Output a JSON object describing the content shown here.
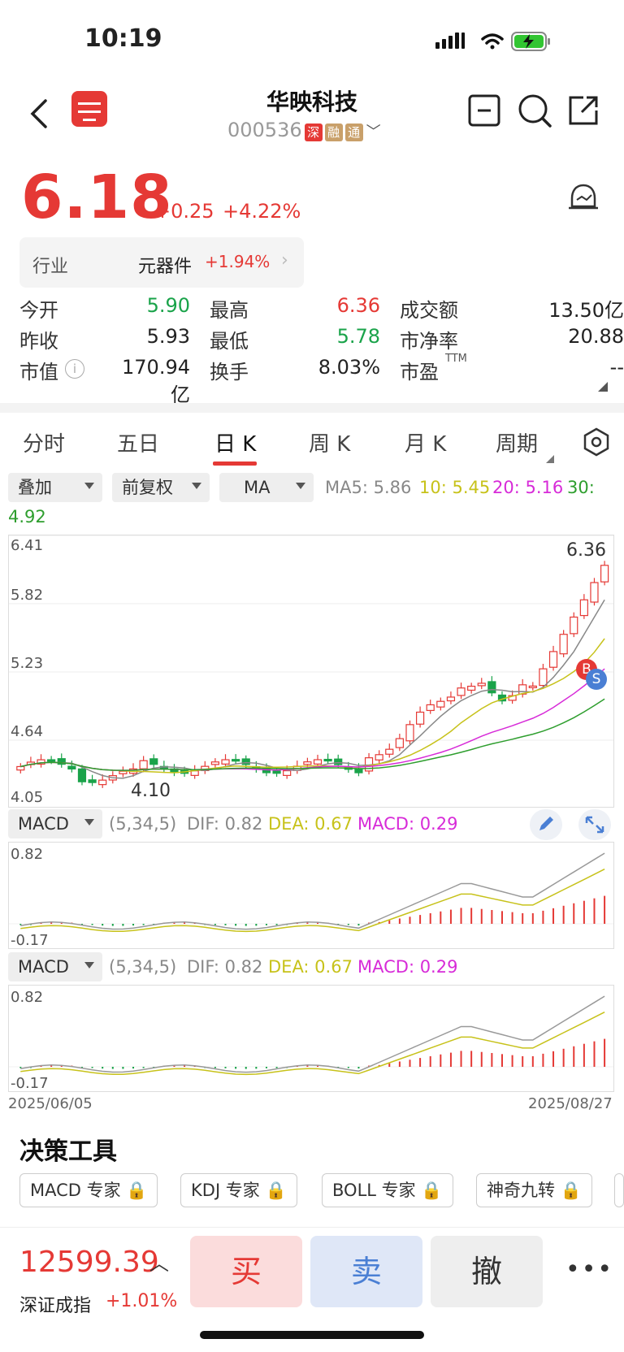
{
  "status": {
    "time": "10:19"
  },
  "header": {
    "stock_name": "华映科技",
    "stock_code": "000536",
    "tags": [
      "深",
      "融",
      "通"
    ],
    "tag_colors": [
      "#e53935",
      "#c9a06a",
      "#c9a06a"
    ]
  },
  "quote": {
    "price": "6.18",
    "change": "+0.25",
    "change_pct": "+4.22%",
    "industry_label": "行业",
    "industry_name": "元器件",
    "industry_change": "+1.94%"
  },
  "stats": [
    {
      "label": "今开",
      "value": "5.90",
      "color": "#1aa34a"
    },
    {
      "label": "最高",
      "value": "6.36",
      "color": "#e53935"
    },
    {
      "label": "成交额",
      "value": "13.50亿",
      "color": "#222"
    },
    {
      "label": "昨收",
      "value": "5.93",
      "color": "#222"
    },
    {
      "label": "最低",
      "value": "5.78",
      "color": "#1aa34a"
    },
    {
      "label": "市净率",
      "value": "20.88",
      "color": "#222"
    },
    {
      "label": "市值",
      "value": "170.94亿",
      "color": "#222"
    },
    {
      "label": "换手",
      "value": "8.03%",
      "color": "#222"
    },
    {
      "label": "市盈",
      "value": "--",
      "color": "#222"
    }
  ],
  "stats_extra": {
    "pe_sup": "TTM"
  },
  "tabs": [
    "分时",
    "五日",
    "日 K",
    "周 K",
    "月 K",
    "周期"
  ],
  "controls": {
    "overlay": "叠加",
    "adjust": "前复权",
    "indicator": "MA"
  },
  "ma": {
    "ma5": "MA5: 5.86",
    "ma10": "10: 5.45",
    "ma20": "20: 5.16",
    "ma30_a": "30:",
    "ma30_b": "4.92"
  },
  "kline": {
    "ticks": [
      "6.41",
      "5.82",
      "5.23",
      "4.64",
      "4.05"
    ],
    "high_label": "6.36",
    "low_label": "4.10",
    "b_marker": "B",
    "s_marker": "S"
  },
  "macd1": {
    "name": "MACD",
    "param": "(5,34,5)",
    "dif": "DIF: 0.82",
    "dea": "DEA: 0.67",
    "macd": "MACD: 0.29",
    "top": "0.82",
    "bottom": "-0.17"
  },
  "macd2": {
    "name": "MACD",
    "param": "(5,34,5)",
    "dif": "DIF: 0.82",
    "dea": "DEA: 0.67",
    "macd": "MACD: 0.29",
    "top": "0.82",
    "bottom": "-0.17"
  },
  "dates": {
    "start": "2025/06/05",
    "end": "2025/08/27"
  },
  "tools": {
    "title": "决策工具",
    "chips": [
      "MACD 专家",
      "KDJ 专家",
      "BOLL 专家",
      "神奇九转"
    ]
  },
  "bottom": {
    "index_value": "12599.39",
    "index_name": "深证成指",
    "index_change": "+1.01%",
    "buy": "买",
    "sell": "卖",
    "cancel": "撤"
  },
  "colors": {
    "up": "#e53935",
    "down": "#1aa34a",
    "ma5": "#888888",
    "ma10": "#c7c21a",
    "ma20": "#d72bd8",
    "ma30": "#2e9e2e"
  }
}
